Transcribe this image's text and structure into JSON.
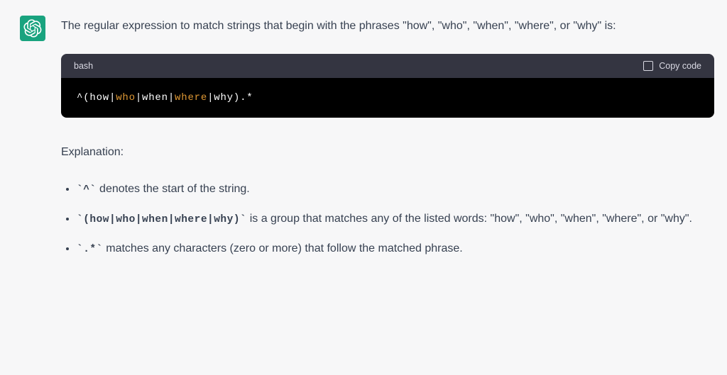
{
  "avatar": {
    "name": "openai-logo"
  },
  "intro": "The regular expression to match strings that begin with the phrases \"how\", \"who\", \"when\", \"where\", or \"why\" is:",
  "code": {
    "language": "bash",
    "copy_label": "Copy code",
    "tokens": [
      {
        "t": "^(how",
        "c": "white"
      },
      {
        "t": "|",
        "c": "white"
      },
      {
        "t": "who",
        "c": "orange"
      },
      {
        "t": "|when|",
        "c": "white"
      },
      {
        "t": "where",
        "c": "orange"
      },
      {
        "t": "|why).*",
        "c": "white"
      }
    ]
  },
  "explanation_heading": "Explanation:",
  "bullets": [
    {
      "code": "`^`",
      "rest": " denotes the start of the string."
    },
    {
      "code": "`(how|who|when|where|why)`",
      "rest": " is a group that matches any of the listed words: \"how\", \"who\", \"when\", \"where\", or \"why\"."
    },
    {
      "code": "`.*`",
      "rest": " matches any characters (zero or more) that follow the matched phrase."
    }
  ]
}
